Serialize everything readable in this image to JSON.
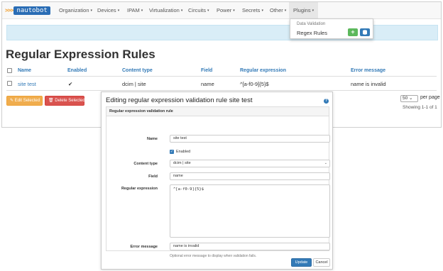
{
  "brand": {
    "chevrons": ">>>",
    "name": "nautobot"
  },
  "nav": {
    "items": [
      "Organization",
      "Devices",
      "IPAM",
      "Virtualization",
      "Circuits",
      "Power",
      "Secrets",
      "Other",
      "Plugins"
    ],
    "caret": "▾",
    "active": "Plugins"
  },
  "dropdown": {
    "header": "Data Validation",
    "item": "Regex Rules",
    "add_symbol": "+"
  },
  "page": {
    "title": "Regular Expression Rules"
  },
  "table": {
    "headers": [
      "Name",
      "Enabled",
      "Content type",
      "Field",
      "Regular expression",
      "Error message"
    ],
    "rows": [
      {
        "name": "site test",
        "enabled": "✔",
        "content_type": "dcim | site",
        "field": "name",
        "regex": "^[a-f0-9]{5}$",
        "error": "name is invalid"
      }
    ]
  },
  "actions": {
    "edit": "Edit Selected",
    "delete": "Delete Selected"
  },
  "pagination": {
    "per_page": "50",
    "caret": "⌄",
    "per_page_label": "per page",
    "showing": "Showing 1-1 of 1"
  },
  "modal": {
    "title": "Editing regular expression validation rule site test",
    "help": "?",
    "panel_heading": "Regular expression validation rule",
    "fields": {
      "name": {
        "label": "Name",
        "value": "site test"
      },
      "enabled": {
        "label": "Enabled",
        "checked": true
      },
      "content_type": {
        "label": "Content type",
        "value": "dcim | site"
      },
      "field": {
        "label": "Field",
        "value": "name"
      },
      "regex": {
        "label": "Regular expression",
        "value": "^[a-f0-9]{5}$"
      },
      "error": {
        "label": "Error message",
        "value": "name is invalid",
        "help": "Optional error message to display when validation fails."
      }
    },
    "buttons": {
      "update": "Update",
      "cancel": "Cancel"
    }
  },
  "colors": {
    "brand_blue": "#2a6db5",
    "link": "#337ab7",
    "success": "#5cb85c",
    "warning": "#f0ad4e",
    "danger": "#d9534f",
    "info_banner": "#d9edf7"
  }
}
